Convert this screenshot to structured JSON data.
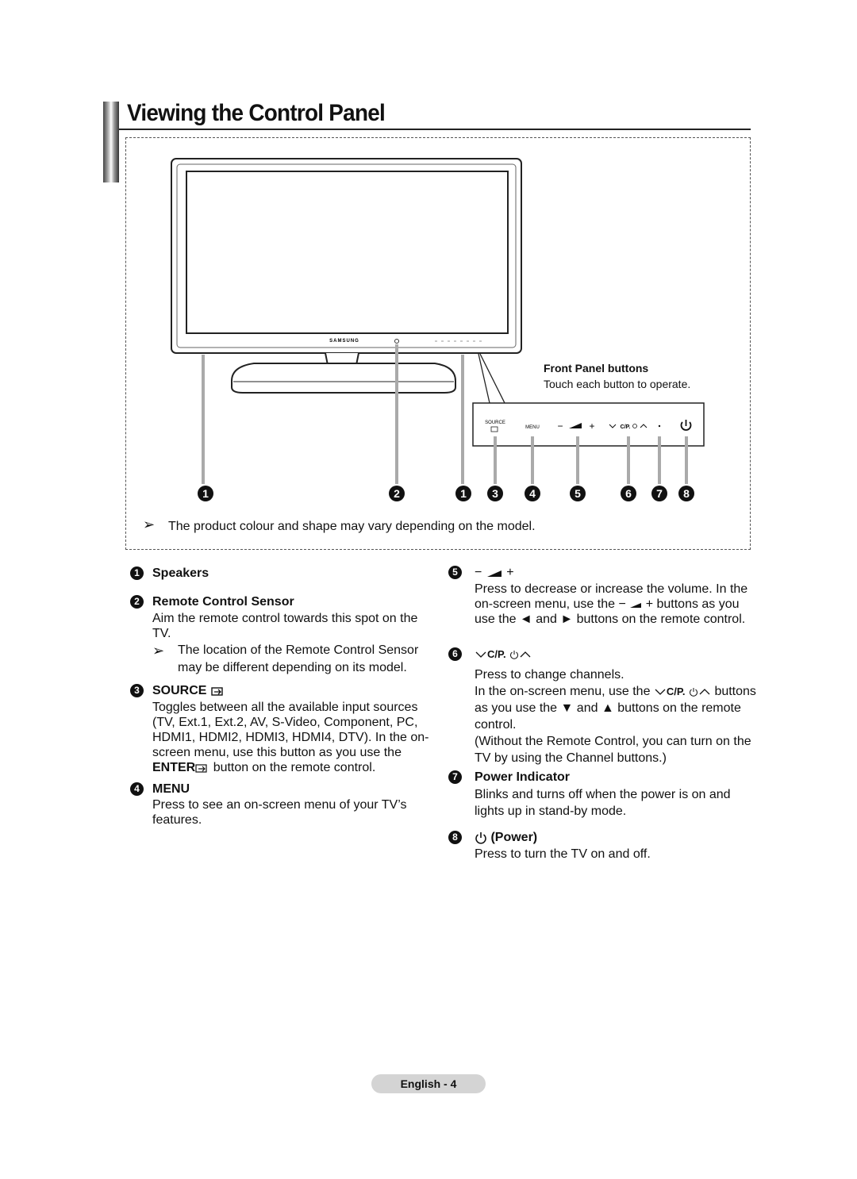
{
  "header": {
    "title": "Viewing the Control Panel"
  },
  "figure": {
    "brand_logo": "SAMSUNG",
    "front_panel_title": "Front Panel buttons",
    "front_panel_subtitle": "Touch each button to operate.",
    "panel_labels": {
      "source": "SOURCE",
      "menu": "MENU",
      "minus": "−",
      "plus": "+",
      "cp": "C/P."
    },
    "callout_numbers": [
      "1",
      "2",
      "1",
      "3",
      "4",
      "5",
      "6",
      "7",
      "8"
    ],
    "note_arrow": "➢",
    "note": "The product colour and shape may vary depending on the model."
  },
  "left_column": {
    "items": [
      {
        "number": "1",
        "title": "Speakers"
      },
      {
        "number": "2",
        "title": "Remote Control Sensor",
        "body": "Aim the remote control towards this spot on the TV.",
        "note": "The location of the Remote Control Sensor may be different depending on its model."
      },
      {
        "number": "3",
        "title": "SOURCE",
        "body": "Toggles between all the available input sources (TV, Ext.1, Ext.2, AV, S-Video, Component, PC, HDMI1, HDMI2, HDMI3, HDMI4, DTV). In the on-screen menu, use this button as you use the",
        "body_bold": "ENTER",
        "body_end": "button on the remote control."
      },
      {
        "number": "4",
        "title": "MENU",
        "body": "Press to see an on-screen menu of your TV’s features."
      }
    ]
  },
  "right_column": {
    "items": [
      {
        "number": "5",
        "title_minus": "−",
        "title_plus": "+",
        "body_1": "Press to decrease or increase the volume. In the on-screen menu, use the −",
        "body_2": "+ buttons as you use the ◄ and ► buttons on the remote control."
      },
      {
        "number": "6",
        "title_cp": "C/P.",
        "body_1": "Press to change channels.",
        "body_2": "In the on-screen menu, use the",
        "body_cp": "C/P.",
        "body_3": "buttons as you use the ▼ and ▲ buttons on the remote control.",
        "body_4": "(Without the Remote Control, you can turn on the TV by using the Channel buttons.)"
      },
      {
        "number": "7",
        "title": "Power Indicator",
        "body": "Blinks and turns off when the power is on and lights up in stand-by mode."
      },
      {
        "number": "8",
        "title": "(Power)",
        "body": "Press to turn the TV on and off."
      }
    ]
  },
  "footer": {
    "page_label": "English - 4"
  },
  "colors": {
    "callout_line": "#aaaaaa",
    "footer_pill": "#d4d4d4",
    "text": "#111111"
  }
}
